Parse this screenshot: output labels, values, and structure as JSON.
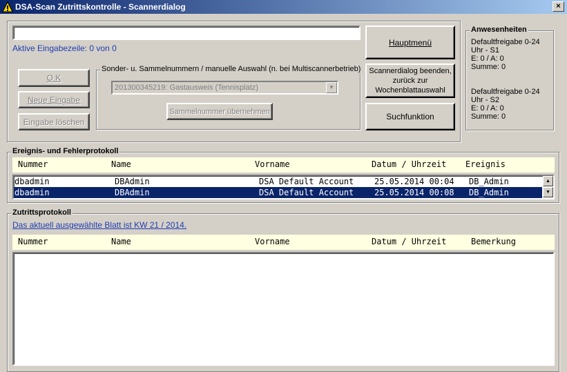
{
  "window": {
    "title": "DSA-Scan Zutrittskontrolle - Scannerdialog",
    "close_glyph": "×"
  },
  "input": {
    "value": "",
    "status": "Aktive Eingabezeile: 0 von 0"
  },
  "buttons": {
    "ok": "O.K",
    "new_input": "Neue Eingabe",
    "clear_input": "Eingabe löschen",
    "main_menu": "Hauptmenü",
    "end_dialog_line1": "Scannerdialog beenden,",
    "end_dialog_line2": "zurück zur",
    "end_dialog_line3": "Wochenblattauswahl",
    "search": "Suchfunktion",
    "take_number": "Sammelnummer übernehmen"
  },
  "special_group": {
    "label": "Sonder- u. Sammelnummern / manuelle Auswahl (n. bei Multiscannerbetrieb)",
    "combo_value": "201300345219:  Gastausweis  (Tennisplatz)"
  },
  "attendance": {
    "label": "Anwesenheiten",
    "block1": [
      "Defaultfreigabe 0-24",
      "Uhr - S1",
      "E: 0 / A: 0",
      "Summe: 0"
    ],
    "block2": [
      "Defaultfreigabe 0-24",
      "Uhr - S2",
      "E: 0 / A: 0",
      "Summe: 0"
    ]
  },
  "event_log": {
    "label": "Ereignis- und Fehlerprotokoll",
    "columns": [
      "Nummer",
      "Name",
      "Vorname",
      "Datum / Uhrzeit",
      "Ereignis"
    ],
    "rows": [
      [
        "dbadmin",
        "DBAdmin",
        "DSA Default Account",
        "25.05.2014 00:04",
        "DB_Admin"
      ],
      [
        "dbadmin",
        "DBAdmin",
        "DSA Default Account",
        "25.05.2014 00:08",
        "DB_Admin"
      ]
    ],
    "selected_row": 1
  },
  "access_log": {
    "label": "Zutrittsprotokoll",
    "sheet_link": "Das aktuell ausgewählte Blatt ist  KW 21 / 2014.",
    "columns": [
      "Nummer",
      "Name",
      "Vorname",
      "Datum / Uhrzeit",
      "Bemerkung"
    ],
    "rows": []
  },
  "colors": {
    "titlebar_start": "#0a246a",
    "titlebar_end": "#a6caf0",
    "selection": "#0a246a",
    "header_bg": "#ffffe1",
    "link": "#1f3cb0"
  }
}
